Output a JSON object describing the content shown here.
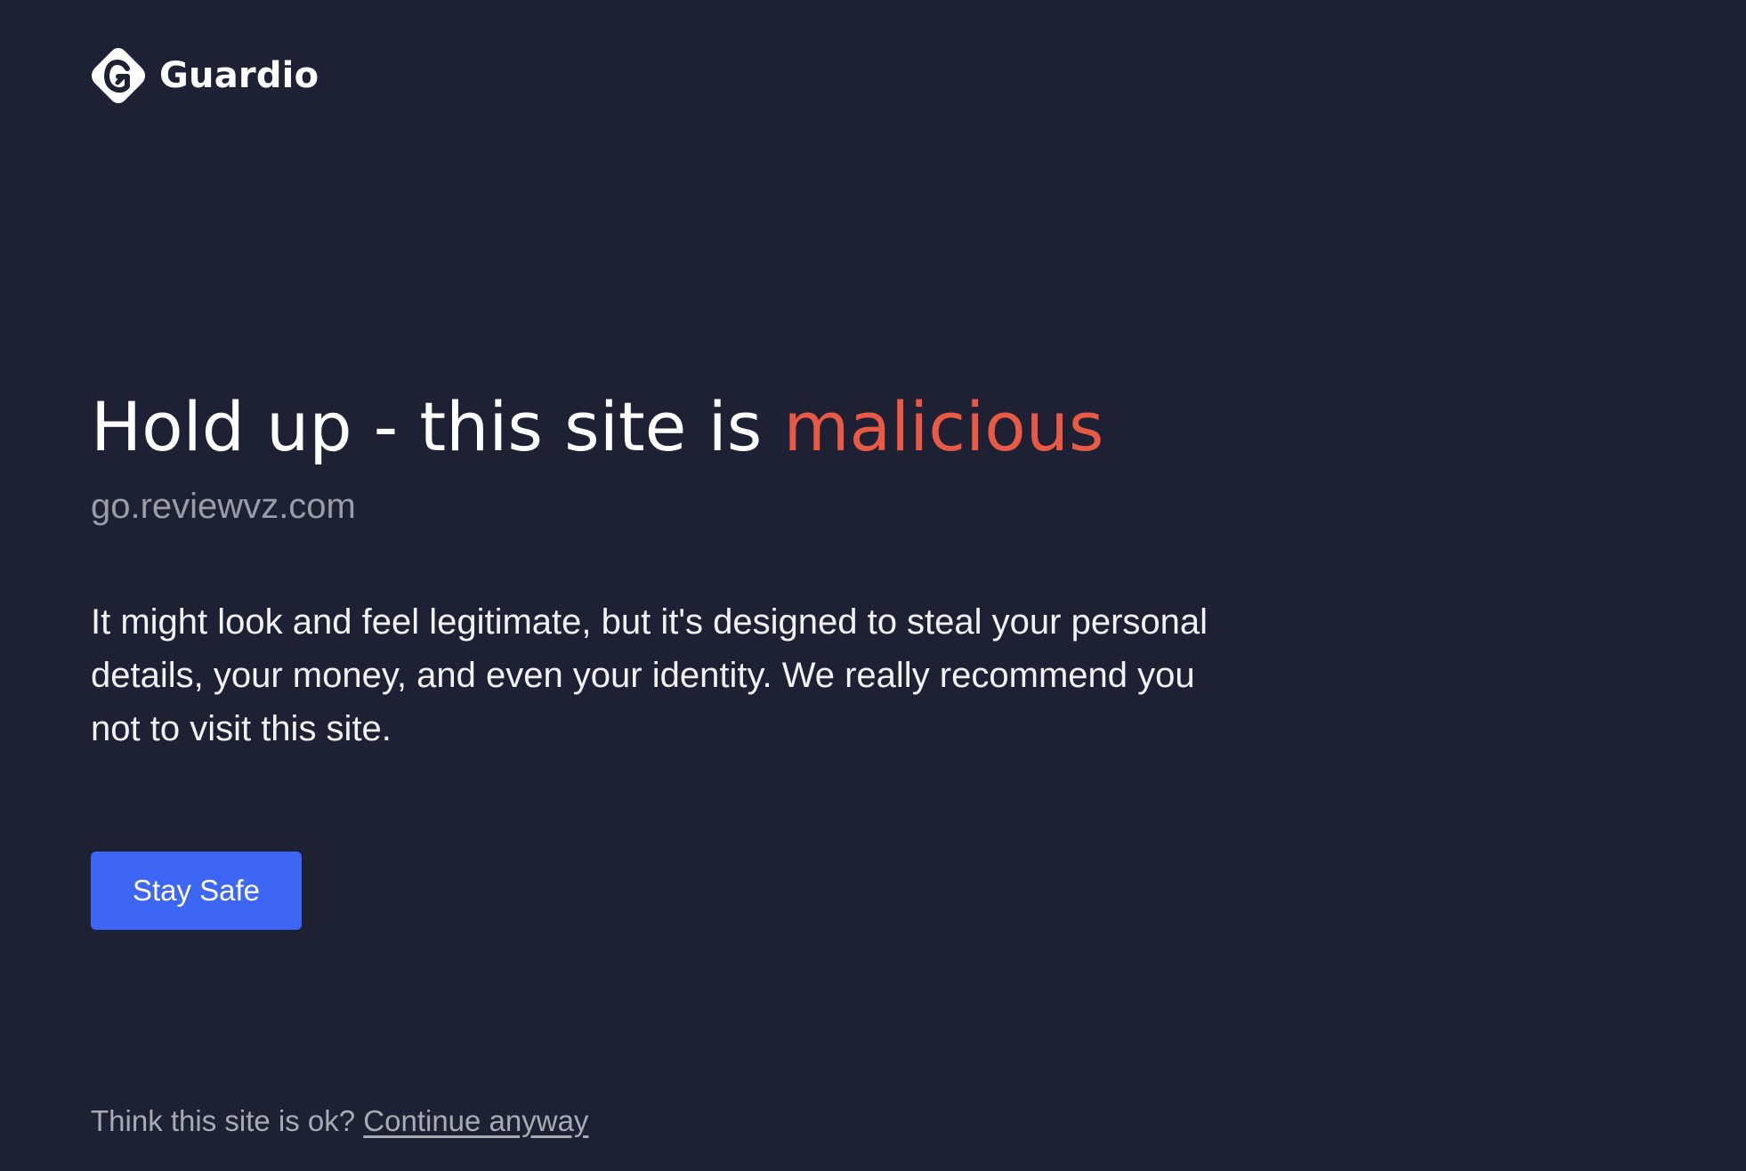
{
  "brand": {
    "name": "Guardio",
    "logo_icon": "guardio-shield-icon"
  },
  "warning": {
    "headline_prefix": "Hold up - this site is ",
    "headline_emphasis": "malicious",
    "emphasis_color": "#e85a45",
    "domain": "go.reviewvz.com",
    "description": "It might look and feel legitimate, but it's designed to steal your personal details, your money, and even your identity. We really recommend you not to visit this site."
  },
  "actions": {
    "stay_safe_label": "Stay Safe",
    "stay_safe_color": "#3d66f5"
  },
  "footer": {
    "prompt": "Think this site is ok? ",
    "continue_label": "Continue anyway"
  },
  "colors": {
    "background": "#1e2034",
    "text": "#ffffff",
    "muted": "#9a9ca7"
  }
}
